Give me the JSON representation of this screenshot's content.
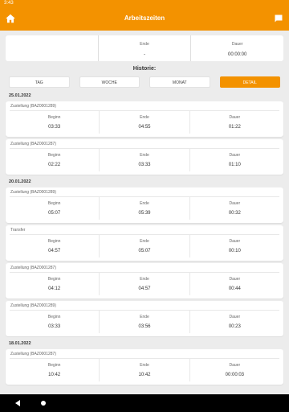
{
  "status": {
    "time": "3:43"
  },
  "header": {
    "title": "Arbeitszeiten",
    "home_icon": "home-icon",
    "chat_icon": "chat-icon"
  },
  "summary": {
    "beginn_label": "",
    "ende_label": "Ende",
    "ende_value": "-",
    "dauer_label": "Dauer",
    "dauer_value": "00:00:00"
  },
  "historie_label": "Historie:",
  "tabs": [
    {
      "label": "TAG",
      "active": false
    },
    {
      "label": "WOCHE",
      "active": false
    },
    {
      "label": "MONAT",
      "active": false
    },
    {
      "label": "DETAIL",
      "active": true
    }
  ],
  "colors": {
    "accent": "#f39200"
  },
  "groups": [
    {
      "date": "25.01.2022",
      "entries": [
        {
          "title": "Zustellung (BAZ0001289)",
          "beginn_label": "Beginn",
          "beginn": "03:33",
          "ende_label": "Ende",
          "ende": "04:55",
          "dauer_label": "Dauer",
          "dauer": "01:22"
        },
        {
          "title": "Zustellung (BAZ0001287)",
          "beginn_label": "Beginn",
          "beginn": "02:22",
          "ende_label": "Ende",
          "ende": "03:33",
          "dauer_label": "Dauer",
          "dauer": "01:10"
        }
      ]
    },
    {
      "date": "20.01.2022",
      "entries": [
        {
          "title": "Zustellung (BAZ0001289)",
          "beginn_label": "Beginn",
          "beginn": "05:07",
          "ende_label": "Ende",
          "ende": "05:39",
          "dauer_label": "Dauer",
          "dauer": "00:32"
        },
        {
          "title": "Transfer",
          "beginn_label": "Beginn",
          "beginn": "04:57",
          "ende_label": "Ende",
          "ende": "05:07",
          "dauer_label": "Dauer",
          "dauer": "00:10"
        },
        {
          "title": "Zustellung (BAZ0001287)",
          "beginn_label": "Beginn",
          "beginn": "04:12",
          "ende_label": "Ende",
          "ende": "04:57",
          "dauer_label": "Dauer",
          "dauer": "00:44"
        },
        {
          "title": "Zustellung (BAZ0001289)",
          "beginn_label": "Beginn",
          "beginn": "03:33",
          "ende_label": "Ende",
          "ende": "03:56",
          "dauer_label": "Dauer",
          "dauer": "00:23"
        }
      ]
    },
    {
      "date": "18.01.2022",
      "entries": [
        {
          "title": "Zustellung (BAZ0001287)",
          "beginn_label": "Beginn",
          "beginn": "10:42",
          "ende_label": "Ende",
          "ende": "10:42",
          "dauer_label": "Dauer",
          "dauer": "00:00:03"
        }
      ]
    }
  ]
}
